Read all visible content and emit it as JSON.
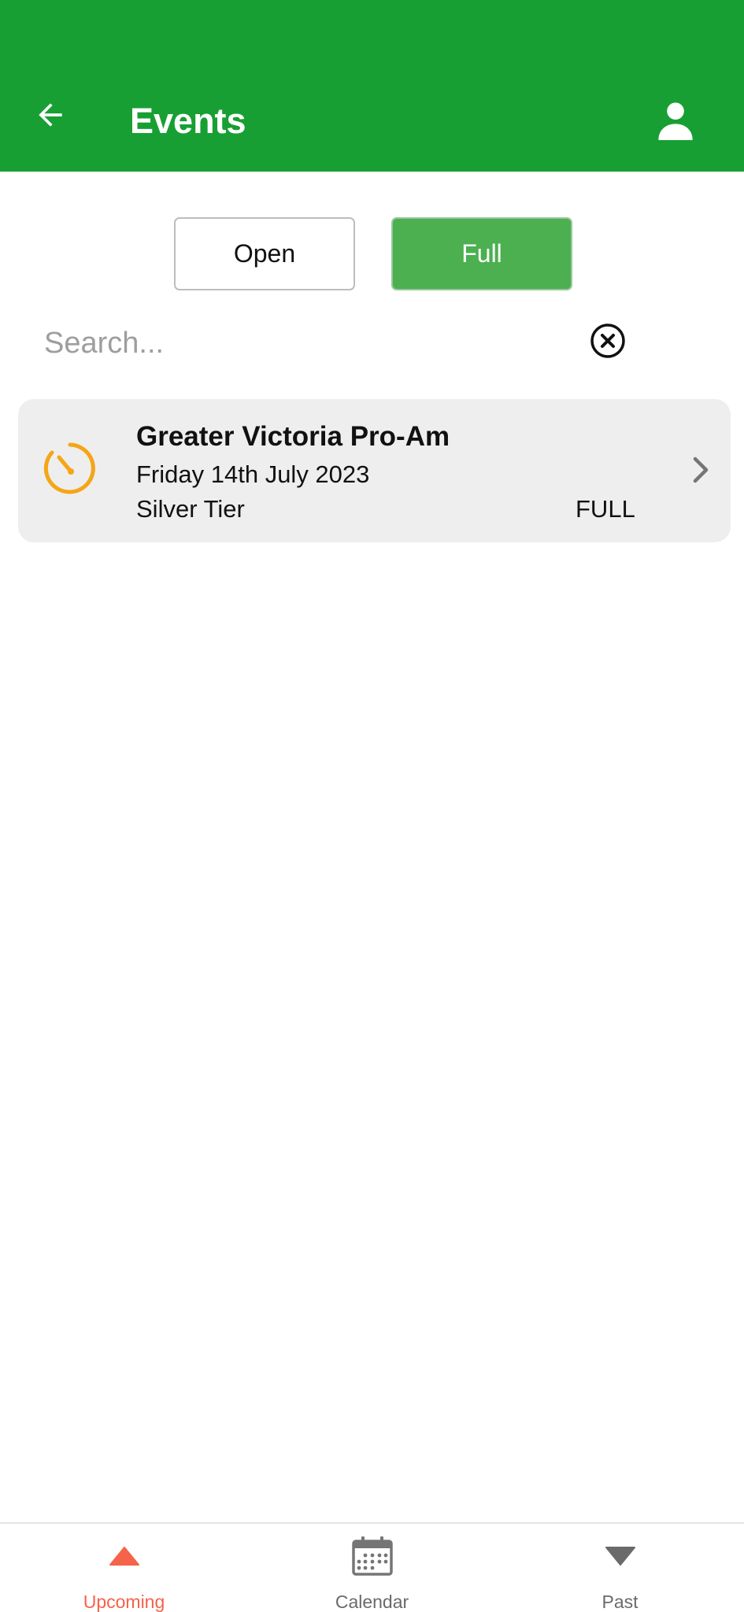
{
  "header": {
    "title": "Events",
    "background_color": "#189f33",
    "back_icon": "arrow-left-icon",
    "profile_icon": "person-icon"
  },
  "filters": {
    "open_label": "Open",
    "full_label": "Full",
    "selected": "Full"
  },
  "search": {
    "placeholder": "Search...",
    "value": "",
    "clear_icon": "close-circle-icon"
  },
  "events": [
    {
      "title": "Greater Victoria Pro-Am",
      "date": "Friday 14th July 2023",
      "tier": "Silver Tier",
      "status": "FULL",
      "icon": "timer-icon",
      "icon_color": "#f5a516"
    }
  ],
  "bottom_nav": {
    "items": [
      {
        "label": "Upcoming",
        "icon": "triangle-up-icon",
        "active": true,
        "color": "#f4634a"
      },
      {
        "label": "Calendar",
        "icon": "calendar-icon",
        "active": false,
        "color": "#6a6a6a"
      },
      {
        "label": "Past",
        "icon": "triangle-down-icon",
        "active": false,
        "color": "#6a6a6a"
      }
    ]
  }
}
